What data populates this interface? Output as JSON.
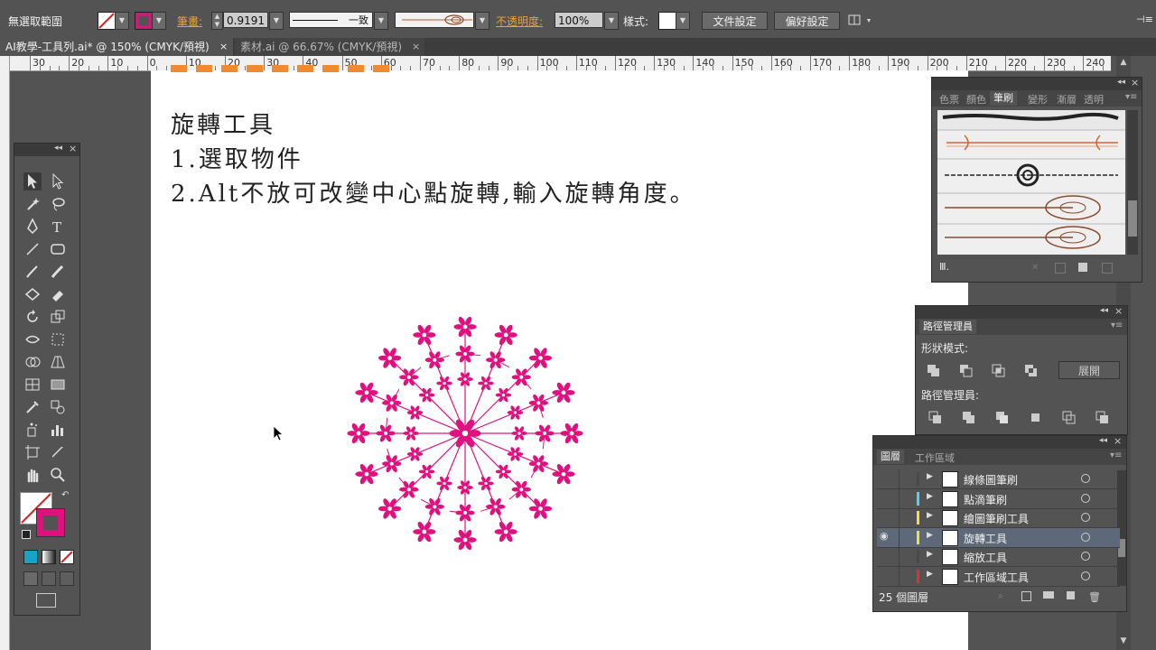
{
  "control_bar": {
    "selection_label": "無選取範圍",
    "stroke_label": "筆畫:",
    "stroke_weight": "0.9191",
    "profile_label": "一致",
    "opacity_label": "不透明度:",
    "opacity_value": "100%",
    "style_label": "樣式:",
    "doc_setup_button": "文件設定",
    "preferences_button": "偏好設定",
    "right_glyph": "⊣≡"
  },
  "tabs": [
    {
      "label": "AI教學-工具列.ai* @ 150% (CMYK/預視)",
      "close": "×"
    },
    {
      "label": "素材.ai @ 66.67% (CMYK/預視)",
      "close": "×"
    }
  ],
  "ruler": {
    "labels": [
      "30",
      "20",
      "10",
      "0",
      "10",
      "20",
      "30",
      "40",
      "50",
      "60",
      "70",
      "80",
      "90",
      "100",
      "110",
      "120",
      "130",
      "140",
      "150",
      "160",
      "170",
      "180",
      "190",
      "200",
      "210",
      "220",
      "230",
      "240"
    ]
  },
  "canvas": {
    "title_line": "旋轉工具",
    "step1": "1.選取物件",
    "step2": "2.Alt不放可改變中心點旋轉,輸入旋轉角度。",
    "accent_color": "#e0117f"
  },
  "brushes_panel": {
    "tabs": [
      "色票",
      "顏色",
      "筆刷",
      "變形",
      "漸層",
      "透明"
    ],
    "selected_tab": "筆刷",
    "footer_menu": "Ⅲ.",
    "brush_colors": [
      "#222222",
      "#d4643a",
      "#555555",
      "#8b4a2a",
      "#8b4a2a"
    ]
  },
  "pathfinder_panel": {
    "tab": "路徑管理員",
    "shape_modes_label": "形狀模式:",
    "expand_button": "展開",
    "pathfinders_label": "路徑管理員:"
  },
  "layers_panel": {
    "tabs": [
      "圖層",
      "工作區域"
    ],
    "selected_tab": "圖層",
    "layers": [
      {
        "name": "線條圖筆刷",
        "color": "#4a4a4a",
        "visible": false,
        "selected": false
      },
      {
        "name": "點滴筆刷",
        "color": "#4fd3f0",
        "visible": false,
        "selected": false
      },
      {
        "name": "繪圖筆刷工具",
        "color": "#f0e040",
        "visible": false,
        "selected": false
      },
      {
        "name": "旋轉工具",
        "color": "#f0e040",
        "visible": true,
        "selected": true
      },
      {
        "name": "縮放工具",
        "color": "#4a4a4a",
        "visible": false,
        "selected": false
      },
      {
        "name": "工作區域工具",
        "color": "#e03030",
        "visible": false,
        "selected": false
      }
    ],
    "count_label": "25 個圖層"
  },
  "toolbox": {
    "fill_color": "#ffffff",
    "stroke_color": "#e0117f"
  }
}
